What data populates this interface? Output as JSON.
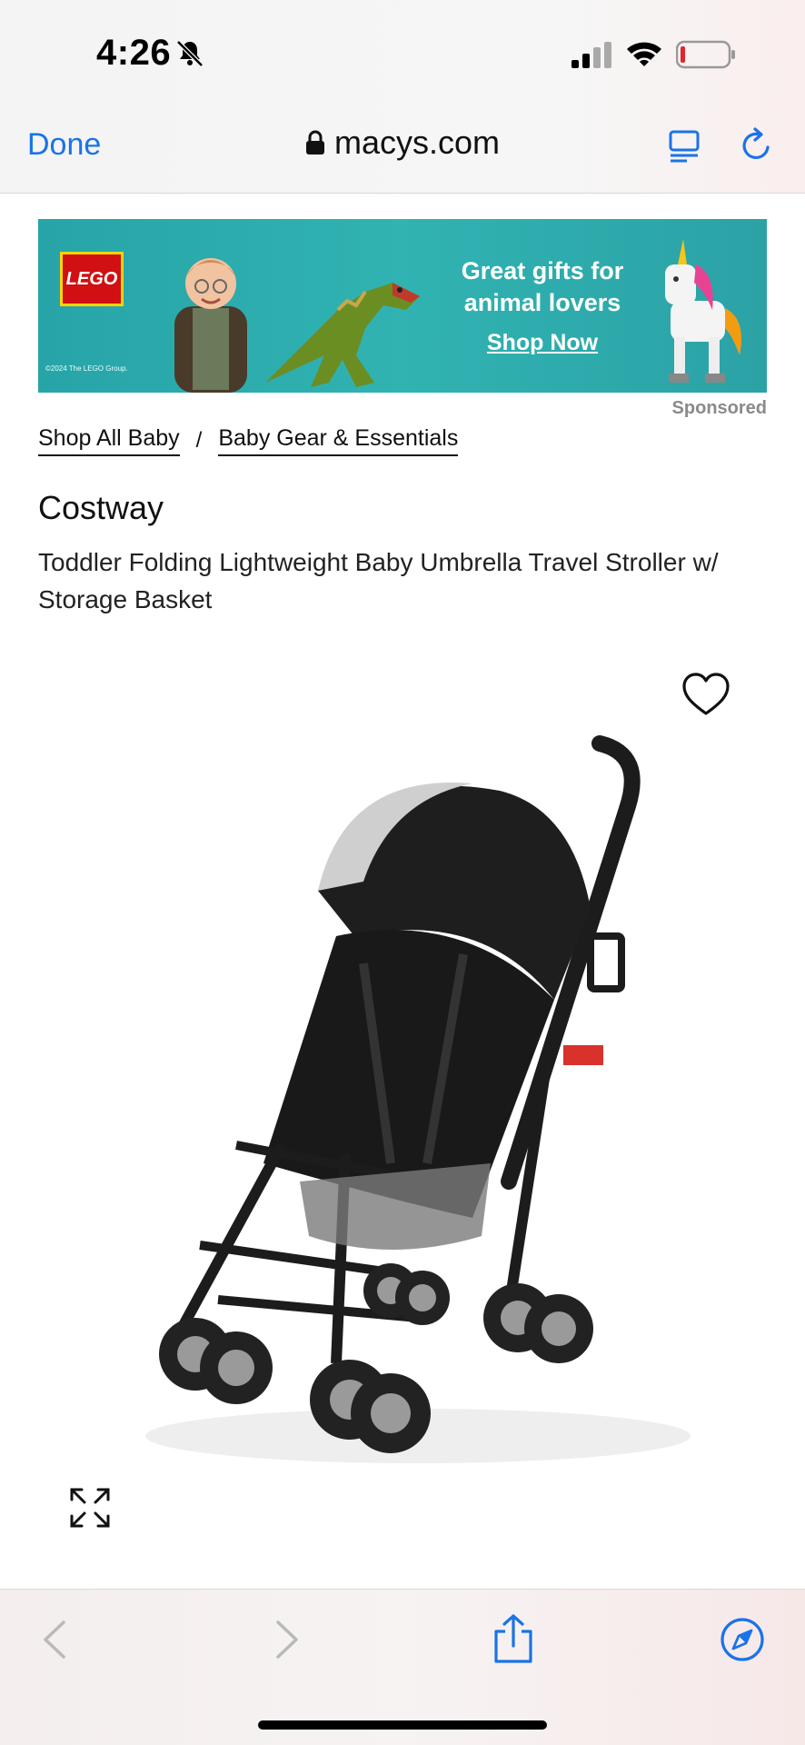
{
  "status_bar": {
    "time": "4:26",
    "icons": [
      "bell-slash-icon",
      "cellular-signal-icon",
      "wifi-icon",
      "battery-icon"
    ]
  },
  "browser": {
    "done_label": "Done",
    "url": "macys.com",
    "icons": [
      "lock-icon",
      "reader-icon",
      "reload-icon"
    ],
    "accent_color": "#1a73e8"
  },
  "ad": {
    "brand": "LEGO",
    "headline": "Great gifts for animal lovers",
    "cta": "Shop Now",
    "copyright": "©2024 The LEGO Group.",
    "sponsored_label": "Sponsored",
    "background_color": "#2ea9ab"
  },
  "breadcrumb": {
    "items": [
      "Shop All Baby",
      "Baby Gear & Essentials"
    ],
    "separator": "/"
  },
  "product": {
    "brand": "Costway",
    "title": "Toddler Folding Lightweight Baby Umbrella Travel Stroller w/ Storage Basket",
    "image": "stroller-image",
    "icons": [
      "heart-icon",
      "expand-icon"
    ]
  },
  "toolbar": {
    "icons": [
      "back-icon",
      "forward-icon",
      "share-icon",
      "compass-icon"
    ]
  }
}
